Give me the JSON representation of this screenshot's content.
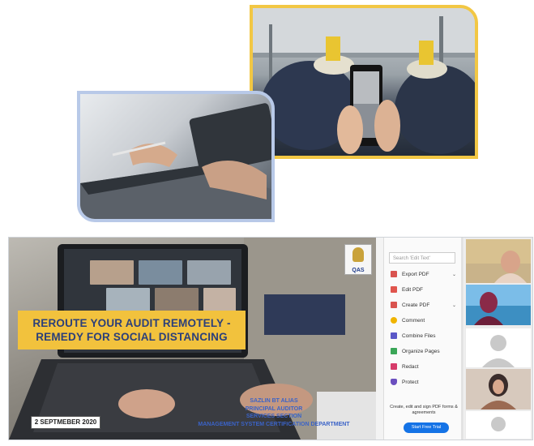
{
  "slide": {
    "headline_line1": "REROUTE YOUR AUDIT REMOTELY -",
    "headline_line2": "REMEDY FOR SOCIAL DISTANCING",
    "date": "2 SEPTMEBER 2020",
    "presenter_lines": [
      "SAZLIN BT ALIAS",
      "PRINCIPAL AUDITOR",
      "SERVICES SECTION",
      "MANAGEMENT SYSTEM CERTIFICATION DEPARTMENT"
    ],
    "logo_text": "QAS"
  },
  "pdf_panel": {
    "search_placeholder": "Search 'Edit Text'",
    "items": [
      {
        "label": "Export PDF",
        "color": "#d9534f"
      },
      {
        "label": "Edit PDF",
        "color": "#e0554d"
      },
      {
        "label": "Create PDF",
        "color": "#d9534f"
      },
      {
        "label": "Comment",
        "color": "#f0b400"
      },
      {
        "label": "Combine Files",
        "color": "#5a57c7"
      },
      {
        "label": "Organize Pages",
        "color": "#3aa657"
      },
      {
        "label": "Redact",
        "color": "#d63b6a"
      },
      {
        "label": "Protect",
        "color": "#6b4fbf"
      }
    ],
    "promo_text": "Create, edit and sign PDF forms & agreements",
    "trial_button": "Start Free Trial"
  },
  "colors": {
    "banner": "#f2c23d",
    "headline_text": "#2b3f7a",
    "presenter_text": "#3b63c7",
    "machine_frame": "#f2c744",
    "laptop_frame": "#b8c9e8",
    "trial_button": "#1473e6"
  }
}
